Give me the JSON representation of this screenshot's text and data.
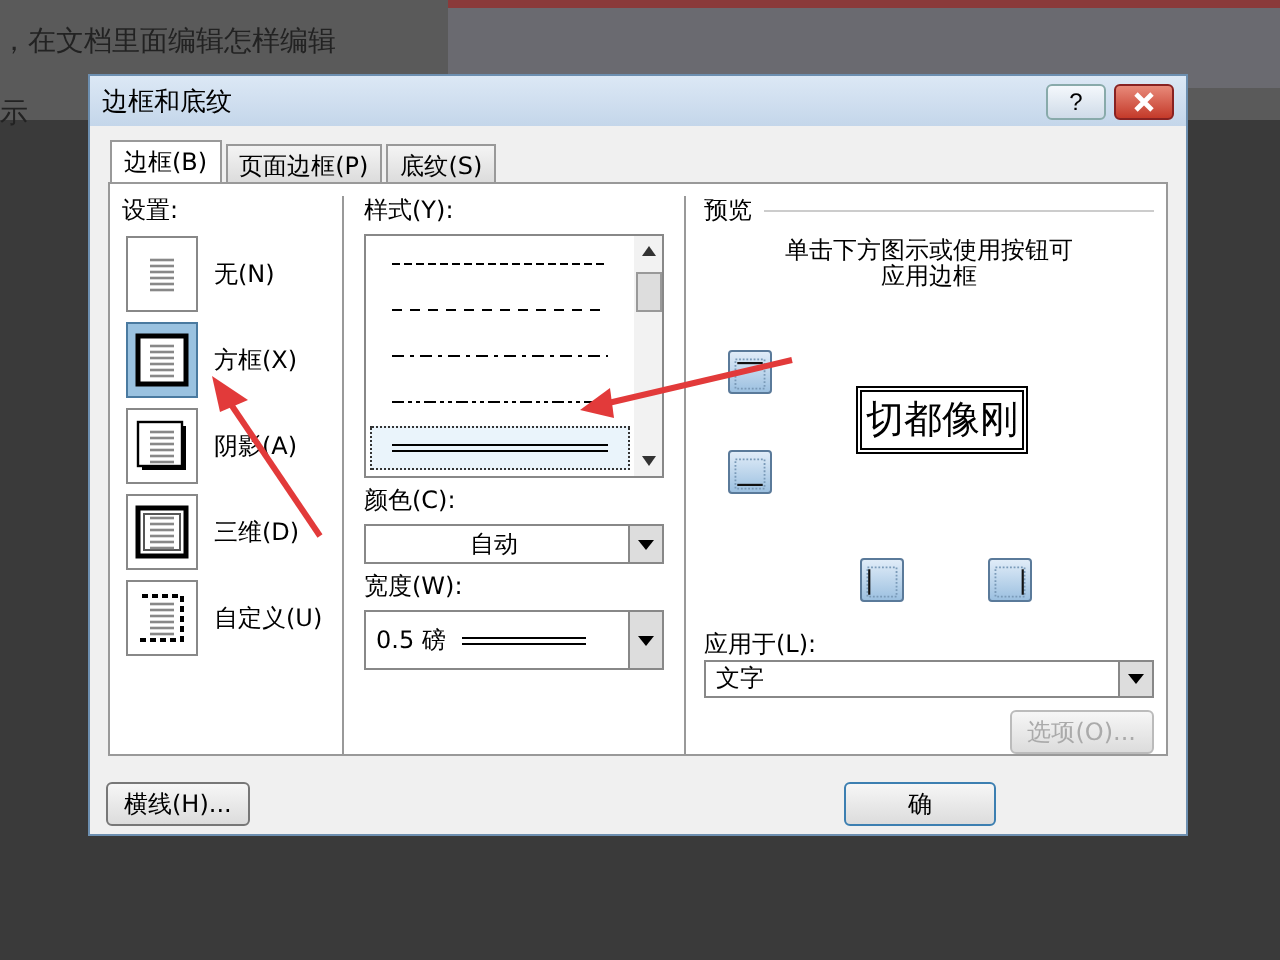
{
  "background": {
    "lines": [
      "，在文档里面编辑怎样编辑",
      "示"
    ]
  },
  "window": {
    "title": "边框和底纹",
    "help": "?"
  },
  "tabs": [
    {
      "label": "边框(B)",
      "selected": true
    },
    {
      "label": "页面边框(P)",
      "selected": false
    },
    {
      "label": "底纹(S)",
      "selected": false
    }
  ],
  "settings": {
    "label": "设置:",
    "items": [
      {
        "label": "无(N)",
        "kind": "none",
        "selected": false
      },
      {
        "label": "方框(X)",
        "kind": "box",
        "selected": true
      },
      {
        "label": "阴影(A)",
        "kind": "shadow",
        "selected": false
      },
      {
        "label": "三维(D)",
        "kind": "three-d",
        "selected": false
      },
      {
        "label": "自定义(U)",
        "kind": "custom",
        "selected": false
      }
    ]
  },
  "style": {
    "label": "样式(Y):",
    "lines": [
      {
        "kind": "fine-dash",
        "selected": false
      },
      {
        "kind": "dash",
        "selected": false
      },
      {
        "kind": "dash-dot",
        "selected": false
      },
      {
        "kind": "dash-dot-dot",
        "selected": false
      },
      {
        "kind": "double",
        "selected": true
      }
    ]
  },
  "color": {
    "label": "颜色(C):",
    "value": "自动"
  },
  "width": {
    "label": "宽度(W):",
    "value": "0.5 磅"
  },
  "preview": {
    "label": "预览",
    "hint_lines": [
      "单击下方图示或使用按钮可",
      "应用边框"
    ],
    "sample_text": "切都像刚",
    "border_buttons": [
      {
        "kind": "top"
      },
      {
        "kind": "bottom"
      },
      {
        "kind": "left"
      },
      {
        "kind": "right"
      }
    ]
  },
  "apply_to": {
    "label": "应用于(L):",
    "value": "文字"
  },
  "options_button": {
    "label": "选项(O)...",
    "disabled": true
  },
  "buttons": [
    {
      "kind": "horizontal-line",
      "label": "横线(H)..."
    },
    {
      "kind": "ok",
      "label": "确"
    }
  ]
}
